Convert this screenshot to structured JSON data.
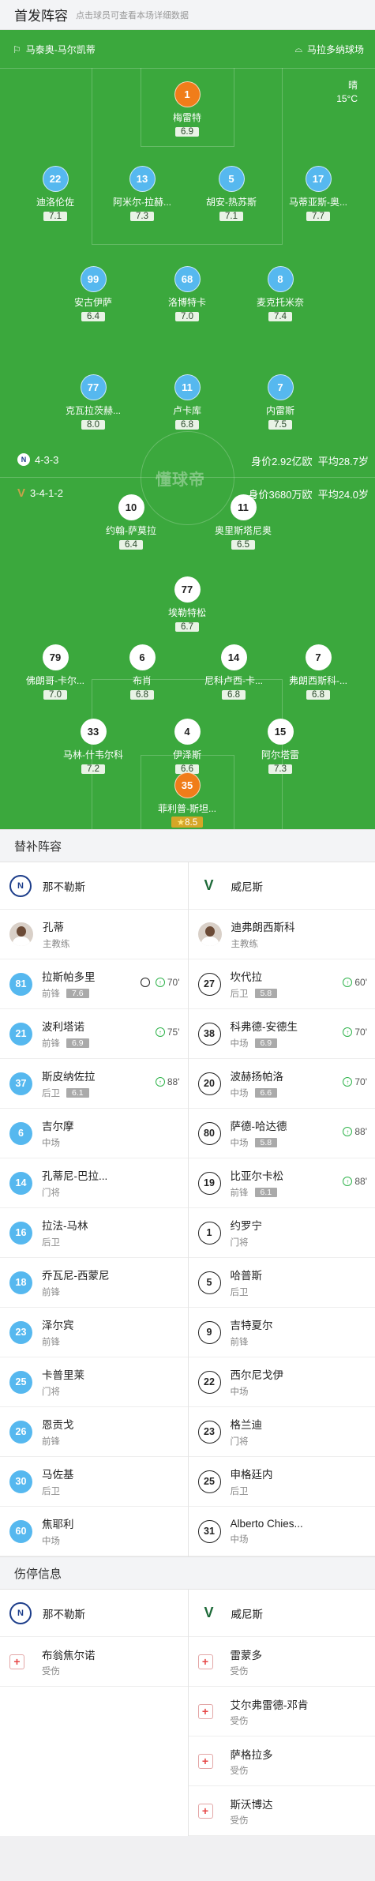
{
  "header": {
    "title": "首发阵容",
    "hint": "点击球员可查看本场详细数据"
  },
  "pitch": {
    "home_team": "马泰奥-马尔凯蒂",
    "away_team": "马拉多纳球场",
    "weather": "晴",
    "temperature": "15°C",
    "watermark": "懂球帝",
    "home_formation": "4-3-3",
    "home_value": "身价2.92亿欧",
    "home_age": "平均28.7岁",
    "away_formation": "3-4-1-2",
    "away_value": "身价3680万欧",
    "away_age": "平均24.0岁"
  },
  "players": [
    {
      "num": "1",
      "name": "梅雷特",
      "rating": "6.9",
      "color": "orange"
    },
    {
      "num": "22",
      "name": "迪洛伦佐",
      "rating": "7.1",
      "color": "blue",
      "captain": "C"
    },
    {
      "num": "13",
      "name": "阿米尔-拉赫...",
      "rating": "7.3",
      "color": "blue"
    },
    {
      "num": "5",
      "name": "胡安-热苏斯",
      "rating": "7.1",
      "color": "blue"
    },
    {
      "num": "17",
      "name": "马蒂亚斯-奥...",
      "rating": "7.7",
      "color": "blue",
      "sub_min": "88'"
    },
    {
      "num": "99",
      "name": "安古伊萨",
      "rating": "6.4",
      "color": "blue",
      "sub_min": "70'"
    },
    {
      "num": "68",
      "name": "洛博特卡",
      "rating": "7.0",
      "color": "blue"
    },
    {
      "num": "8",
      "name": "麦克托米奈",
      "rating": "7.4",
      "color": "blue"
    },
    {
      "num": "77",
      "name": "克瓦拉茨赫...",
      "rating": "8.0",
      "color": "blue",
      "sub_min": "75'"
    },
    {
      "num": "11",
      "name": "卢卡库",
      "rating": "6.8",
      "color": "blue"
    },
    {
      "num": "7",
      "name": "内雷斯",
      "rating": "7.5",
      "color": "blue"
    },
    {
      "num": "10",
      "name": "约翰-萨莫拉",
      "rating": "6.4",
      "color": "white",
      "sub_min": "70'"
    },
    {
      "num": "11",
      "name": "奥里斯塔尼奥",
      "rating": "6.5",
      "color": "white",
      "sub_min": "88'"
    },
    {
      "num": "77",
      "name": "埃勒特松",
      "rating": "6.7",
      "color": "white",
      "sub_min": "70'"
    },
    {
      "num": "79",
      "name": "佛朗哥-卡尔...",
      "rating": "7.0",
      "color": "white",
      "sub_min": "60'"
    },
    {
      "num": "6",
      "name": "布肖",
      "rating": "6.8",
      "color": "white"
    },
    {
      "num": "14",
      "name": "尼科卢西-卡...",
      "rating": "6.8",
      "color": "white"
    },
    {
      "num": "7",
      "name": "弗朗西斯科-...",
      "rating": "6.8",
      "color": "white",
      "sub_min": "88'",
      "captain": "C"
    },
    {
      "num": "33",
      "name": "马林-什韦尔科",
      "rating": "7.2",
      "color": "white"
    },
    {
      "num": "4",
      "name": "伊泽斯",
      "rating": "6.6",
      "color": "white"
    },
    {
      "num": "15",
      "name": "阿尔塔雷",
      "rating": "7.3",
      "color": "white"
    },
    {
      "num": "35",
      "name": "菲利普-斯坦...",
      "rating": "8.5",
      "color": "orange",
      "mvp": "★"
    }
  ],
  "bench_title": "替补阵容",
  "home": {
    "name": "那不勒斯",
    "logo": "N"
  },
  "away": {
    "name": "威尼斯",
    "logo": "V"
  },
  "coaches": {
    "home": {
      "name": "孔蒂",
      "role": "主教练"
    },
    "away": {
      "name": "迪弗朗西斯科",
      "role": "主教练"
    }
  },
  "subs_left": [
    {
      "num": "81",
      "name": "拉斯帕多里",
      "pos": "前锋",
      "rating": "7.6",
      "min": "70'",
      "goal": true
    },
    {
      "num": "21",
      "name": "波利塔诺",
      "pos": "前锋",
      "rating": "6.9",
      "min": "75'"
    },
    {
      "num": "37",
      "name": "斯皮纳佐拉",
      "pos": "后卫",
      "rating": "6.1",
      "min": "88'"
    },
    {
      "num": "6",
      "name": "吉尔摩",
      "pos": "中场"
    },
    {
      "num": "14",
      "name": "孔蒂尼-巴拉...",
      "pos": "门将"
    },
    {
      "num": "16",
      "name": "拉法-马林",
      "pos": "后卫"
    },
    {
      "num": "18",
      "name": "乔瓦尼-西蒙尼",
      "pos": "前锋"
    },
    {
      "num": "23",
      "name": "泽尔宾",
      "pos": "前锋"
    },
    {
      "num": "25",
      "name": "卡普里莱",
      "pos": "门将"
    },
    {
      "num": "26",
      "name": "恩贡戈",
      "pos": "前锋"
    },
    {
      "num": "30",
      "name": "马佐基",
      "pos": "后卫"
    },
    {
      "num": "60",
      "name": "焦耶利",
      "pos": "中场"
    }
  ],
  "subs_right": [
    {
      "num": "27",
      "name": "坎代拉",
      "pos": "后卫",
      "rating": "5.8",
      "min": "60'"
    },
    {
      "num": "38",
      "name": "科弗德-安德生",
      "pos": "中场",
      "rating": "6.9",
      "min": "70'"
    },
    {
      "num": "20",
      "name": "波赫扬帕洛",
      "pos": "中场",
      "rating": "6.6",
      "min": "70'"
    },
    {
      "num": "80",
      "name": "萨德-哈达德",
      "pos": "中场",
      "rating": "5.8",
      "min": "88'"
    },
    {
      "num": "19",
      "name": "比亚尔卡松",
      "pos": "前锋",
      "rating": "6.1",
      "min": "88'"
    },
    {
      "num": "1",
      "name": "约罗宁",
      "pos": "门将"
    },
    {
      "num": "5",
      "name": "哈普斯",
      "pos": "后卫"
    },
    {
      "num": "9",
      "name": "吉特夏尔",
      "pos": "前锋"
    },
    {
      "num": "22",
      "name": "西尔尼戈伊",
      "pos": "中场"
    },
    {
      "num": "23",
      "name": "格兰迪",
      "pos": "门将"
    },
    {
      "num": "25",
      "name": "申格廷内",
      "pos": "后卫"
    },
    {
      "num": "31",
      "name": "Alberto Chies...",
      "pos": "中场"
    }
  ],
  "injury_title": "伤停信息",
  "injury_left": [
    {
      "name": "布翁焦尔诺",
      "status": "受伤"
    }
  ],
  "injury_right": [
    {
      "name": "雷蒙多",
      "status": "受伤"
    },
    {
      "name": "艾尔弗雷德-邓肯",
      "status": "受伤"
    },
    {
      "name": "萨格拉多",
      "status": "受伤"
    },
    {
      "name": "斯沃博达",
      "status": "受伤"
    }
  ]
}
